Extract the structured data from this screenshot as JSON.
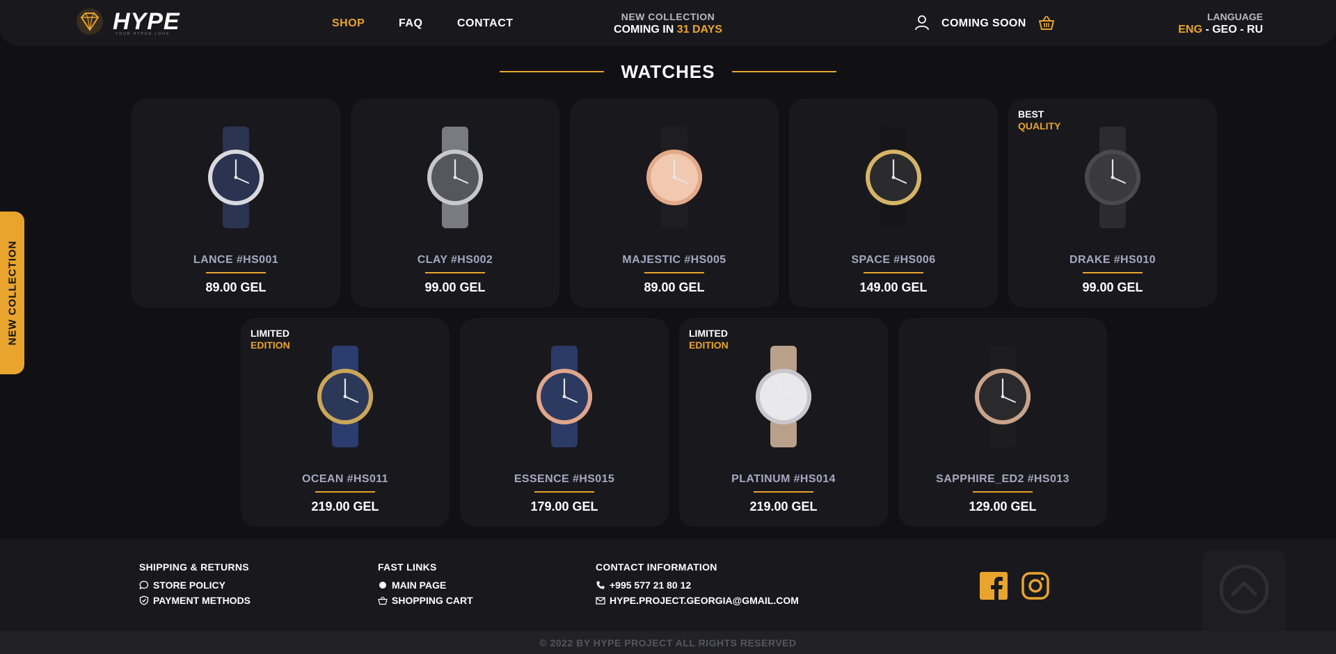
{
  "brand": {
    "name": "HYPE",
    "tagline": "YOUR HYPED LOOK"
  },
  "nav": {
    "shop": "SHOP",
    "faq": "FAQ",
    "contact": "CONTACT"
  },
  "collection": {
    "label": "NEW COLLECTION",
    "coming_prefix": "COMING IN",
    "days": "31 DAYS"
  },
  "account": {
    "coming_soon": "COMING SOON"
  },
  "language": {
    "label": "LANGUAGE",
    "eng": "ENG",
    "sep": " - ",
    "geo": "GEO",
    "ru": "RU"
  },
  "section": {
    "title": "WATCHES"
  },
  "side_tab": {
    "label": "NEW COLLECTION"
  },
  "products": [
    {
      "name": "LANCE #HS001",
      "price": "89.00 GEL",
      "badge1": "",
      "badge2": "",
      "face": "#2a3350",
      "strap": "#2b3450",
      "case": "#d9d9de"
    },
    {
      "name": "CLAY #HS002",
      "price": "99.00 GEL",
      "badge1": "",
      "badge2": "",
      "face": "#55575c",
      "strap": "#7a7b80",
      "case": "#c8c8cc"
    },
    {
      "name": "MAJESTIC #HS005",
      "price": "89.00 GEL",
      "badge1": "",
      "badge2": "",
      "face": "#f0c9b0",
      "strap": "#1e1e20",
      "case": "#e3a98a"
    },
    {
      "name": "SPACE #HS006",
      "price": "149.00 GEL",
      "badge1": "",
      "badge2": "",
      "face": "#2b2b2e",
      "strap": "#161618",
      "case": "#d6b466"
    },
    {
      "name": "DRAKE #HS010",
      "price": "99.00 GEL",
      "badge1": "BEST",
      "badge2": "QUALITY",
      "face": "#3a3a3d",
      "strap": "#2c2c2f",
      "case": "#4a4a4d"
    },
    {
      "name": "OCEAN #HS011",
      "price": "219.00 GEL",
      "badge1": "LIMITED",
      "badge2": "EDITION",
      "face": "#2c3858",
      "strap": "#2b3c6e",
      "case": "#c9a65a"
    },
    {
      "name": "ESSENCE #HS015",
      "price": "179.00 GEL",
      "badge1": "",
      "badge2": "",
      "face": "#2c3a62",
      "strap": "#2b3a66",
      "case": "#e0a68c"
    },
    {
      "name": "PLATINUM #HS014",
      "price": "219.00 GEL",
      "badge1": "LIMITED",
      "badge2": "EDITION",
      "face": "#e9e9ec",
      "strap": "#b9a08a",
      "case": "#c8c8cc"
    },
    {
      "name": "SAPPHIRE_ED2 #HS013",
      "price": "129.00 GEL",
      "badge1": "",
      "badge2": "",
      "face": "#2a2a2d",
      "strap": "#1d1d20",
      "case": "#c9a48a"
    }
  ],
  "footer": {
    "col1": {
      "title": "SHIPPING & RETURNS",
      "items": [
        "STORE POLICY",
        "PAYMENT METHODS"
      ]
    },
    "col2": {
      "title": "FAST LINKS",
      "items": [
        "MAIN PAGE",
        "SHOPPING CART"
      ]
    },
    "col3": {
      "title": "CONTACT INFORMATION",
      "phone": "+995 577 21 80 12",
      "email": "HYPE.PROJECT.GEORGIA@GMAIL.COM"
    },
    "copyright": "© 2022 BY HYPE PROJECT ALL RIGHTS RESERVED"
  },
  "colors": {
    "accent": "#e8a42d",
    "background": "#111114",
    "card": "#19191d"
  }
}
